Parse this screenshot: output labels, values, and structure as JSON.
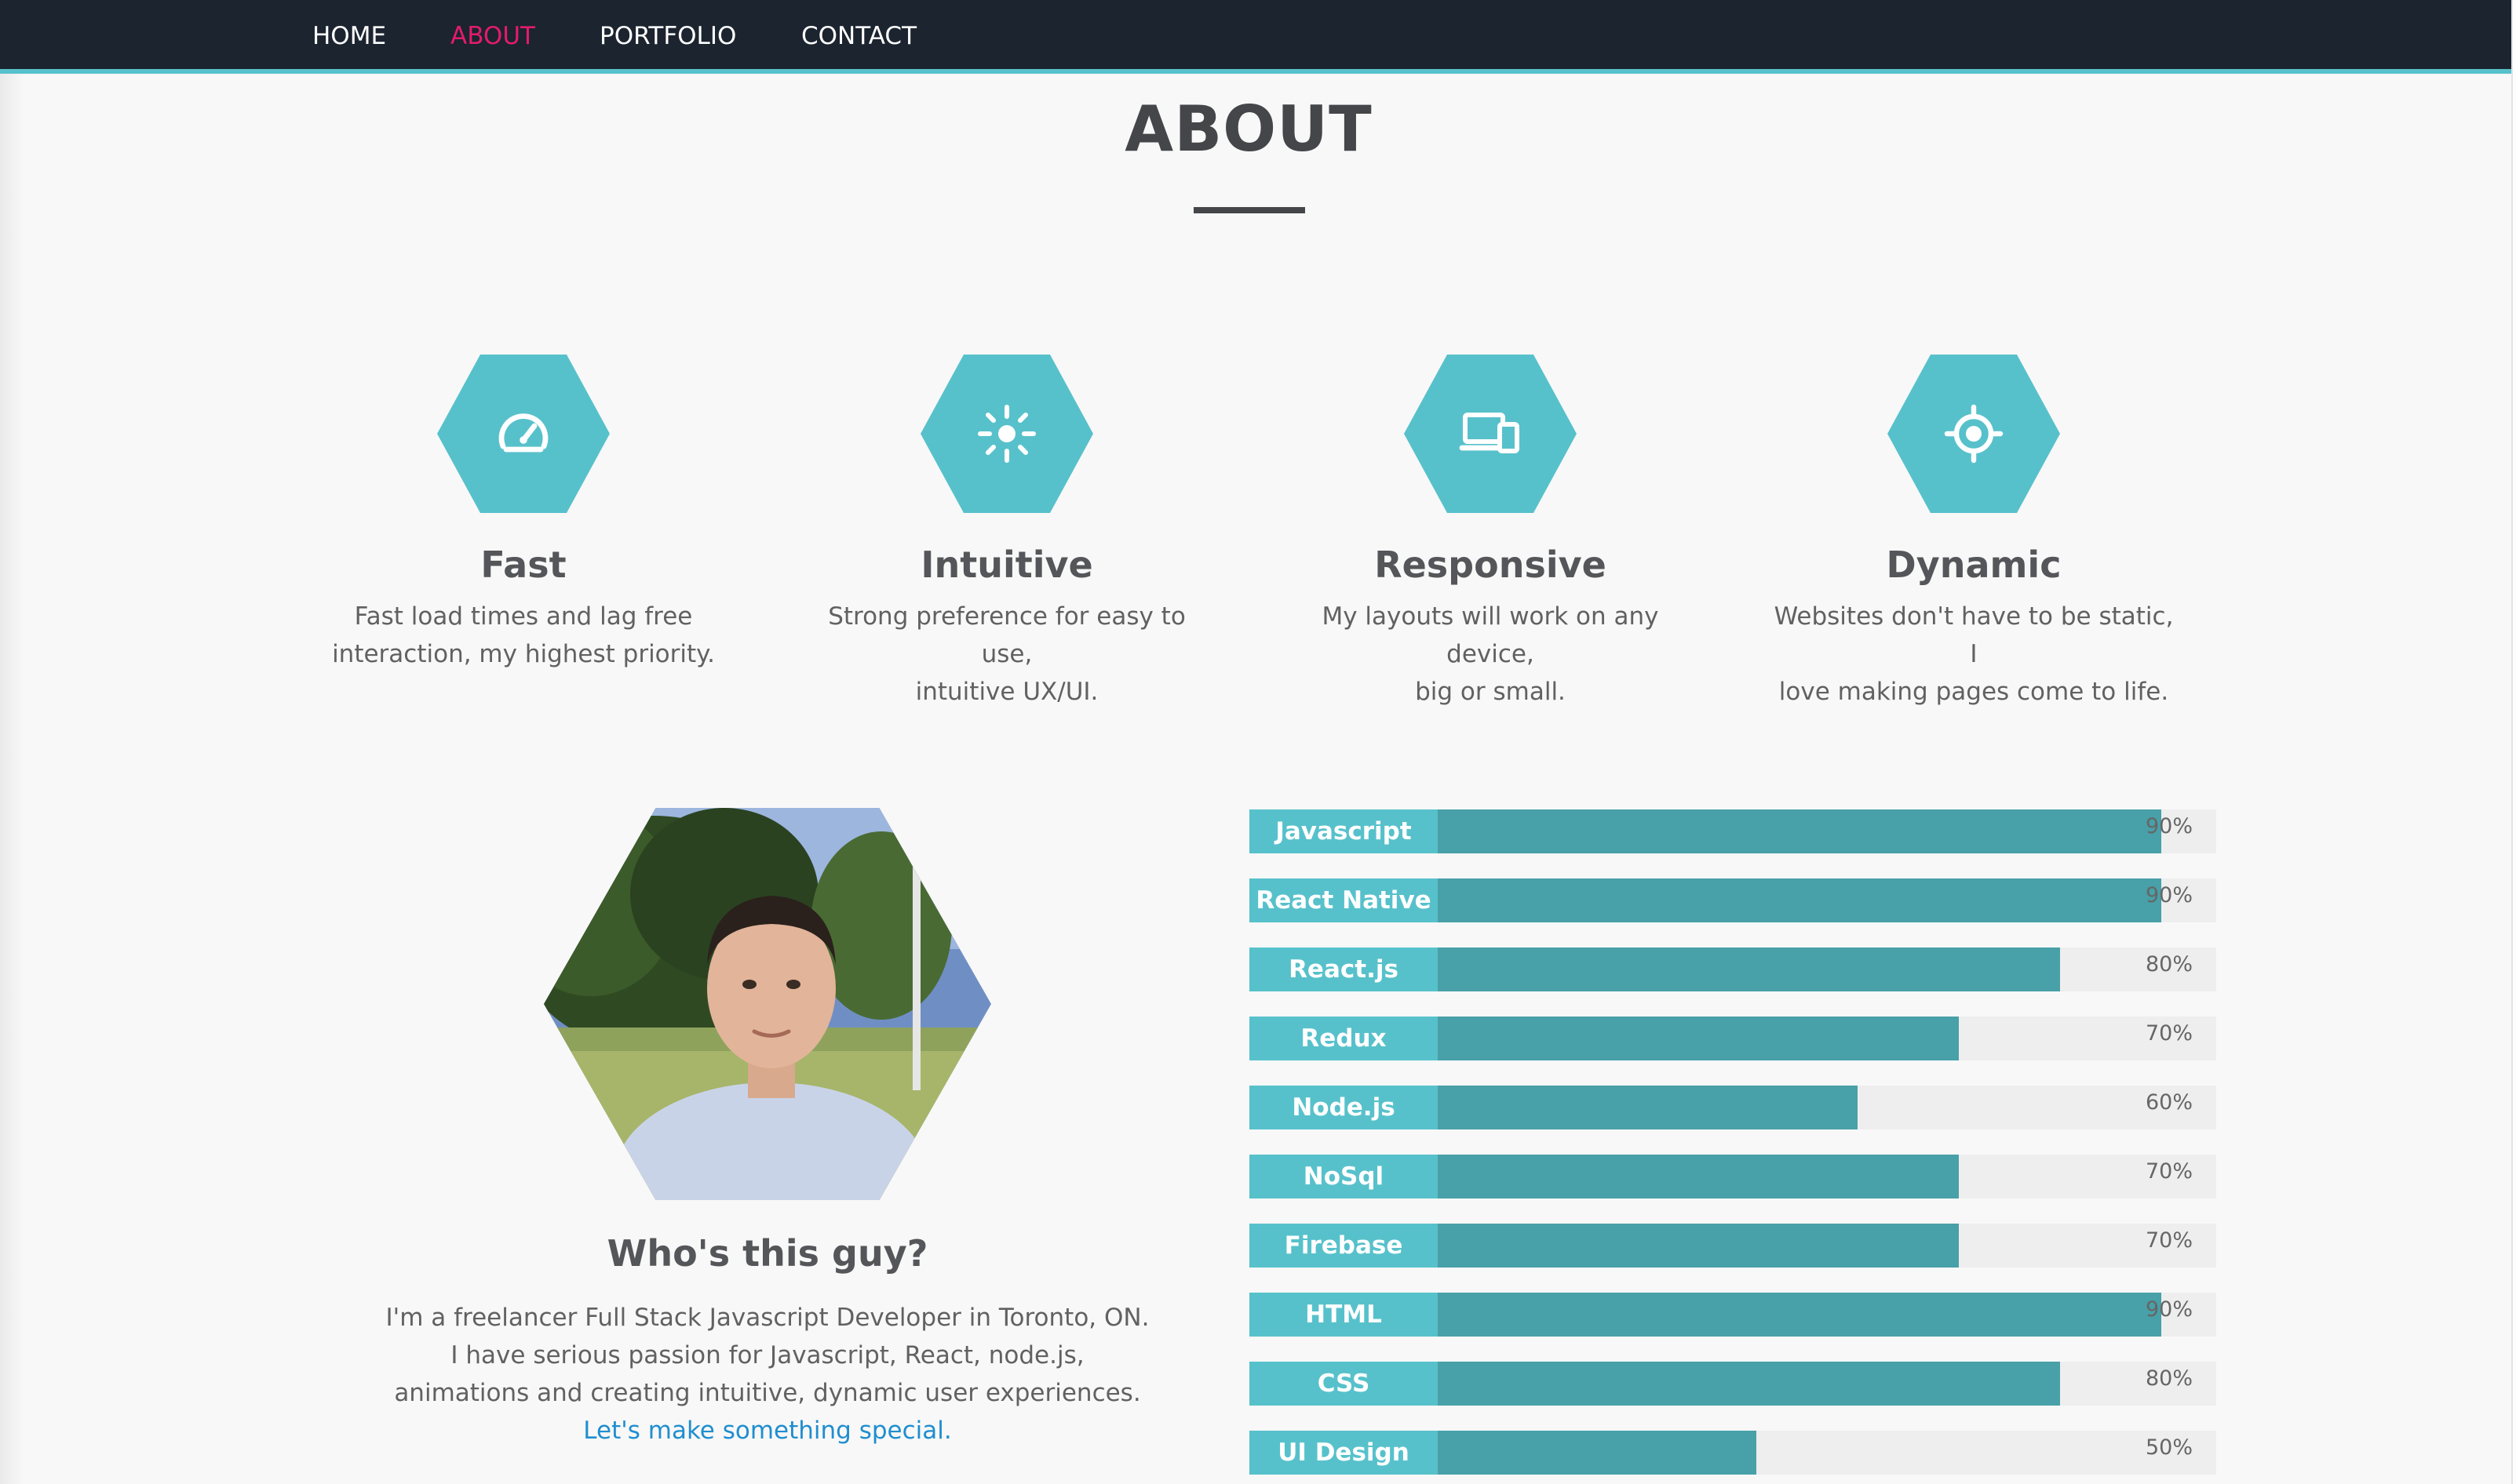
{
  "nav": {
    "items": [
      {
        "label": "HOME",
        "active": false
      },
      {
        "label": "ABOUT",
        "active": true
      },
      {
        "label": "PORTFOLIO",
        "active": false
      },
      {
        "label": "CONTACT",
        "active": false
      }
    ]
  },
  "about": {
    "title": "ABOUT"
  },
  "features": [
    {
      "icon": "speedometer-icon",
      "title": "Fast",
      "desc_line1": "Fast load times and lag free",
      "desc_line2": "interaction, my highest priority."
    },
    {
      "icon": "lightbulb-icon",
      "title": "Intuitive",
      "desc_line1": "Strong preference for easy to use,",
      "desc_line2": "intuitive UX/UI."
    },
    {
      "icon": "devices-icon",
      "title": "Responsive",
      "desc_line1": "My layouts will work on any device,",
      "desc_line2": "big or small."
    },
    {
      "icon": "target-icon",
      "title": "Dynamic",
      "desc_line1": "Websites don't have to be static, I",
      "desc_line2": "love making pages come to life."
    }
  ],
  "profile": {
    "heading": "Who's this guy?",
    "line1": "I'm a freelancer Full Stack Javascript Developer in Toronto, ON.",
    "line2": "I have serious passion for Javascript, React, node.js,",
    "line3": "animations and creating intuitive, dynamic user experiences.",
    "cta": "Let's make something special."
  },
  "skills": [
    {
      "name": "Javascript",
      "percent_label": "90%",
      "value": 90
    },
    {
      "name": "React Native",
      "percent_label": "90%",
      "value": 90
    },
    {
      "name": "React.js",
      "percent_label": "80%",
      "value": 80
    },
    {
      "name": "Redux",
      "percent_label": "70%",
      "value": 70
    },
    {
      "name": "Node.js",
      "percent_label": "60%",
      "value": 60
    },
    {
      "name": "NoSql",
      "percent_label": "70%",
      "value": 70
    },
    {
      "name": "Firebase",
      "percent_label": "70%",
      "value": 70
    },
    {
      "name": "HTML",
      "percent_label": "90%",
      "value": 90
    },
    {
      "name": "CSS",
      "percent_label": "80%",
      "value": 80
    },
    {
      "name": "UI Design",
      "percent_label": "50%",
      "value": 50
    }
  ],
  "colors": {
    "nav_bg": "#1b242f",
    "nav_active": "#e31b6d",
    "accent": "#57c1cb",
    "bar_fill": "#48a0a8",
    "link": "#1f8ecf"
  }
}
